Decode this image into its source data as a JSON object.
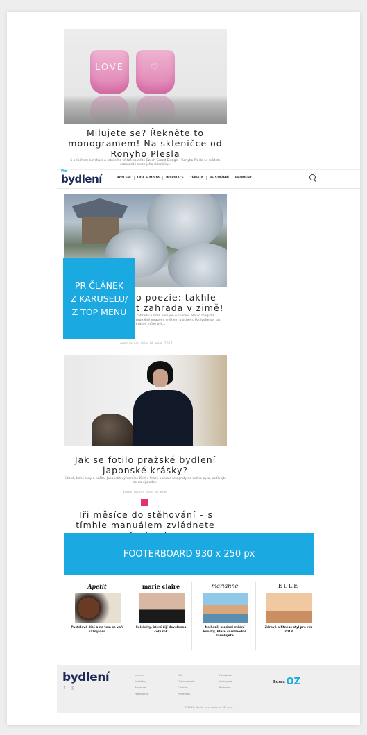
{
  "articles": [
    {
      "title": "Milujete se? Řekněte to monogramem! Na skleničce od Ronyho Plesla",
      "excerpt": "S příběhem návrháře a letošního vítěze soutěže Czech Grand Design – Ronyho Plesla se můžete seznámit i skrze jeho skleničky...",
      "glass_left": "LOVE",
      "glass_right": "♡"
    },
    {
      "title": "Zimní poezie: takhle vypadá zahrada v zimě!",
      "title_visible_part1": "o poezie: takhle",
      "title_visible_part2": "t zahrada v zimě!",
      "excerpt": "Zahrada v zimě není jen o spánku, ale i o magické proměně mrazem, sněhem a tichem. Podívejte se, jak krásné může být...",
      "meta": "Lorem ipsum, dolor sit amet, 2017"
    },
    {
      "title": "Jak se fotilo pražské bydlení japonské krásky?",
      "excerpt": "Sítová, tiché tóny a kočka. Japonská výtvarnice žijící v Praze pozvala fotografy do svého bytu, podívejte se na výsledek.",
      "meta": "Lorem ipsum, dolor sit amet"
    },
    {
      "title": "Tři měsíce do stěhování – s tímhle manuálem zvládnete všechno!"
    }
  ],
  "nav": {
    "logo_top": "Pro",
    "logo": "bydlení",
    "items": [
      "BYDLENÍ",
      "LIDÉ & MÍSTA",
      "INSPIRACE",
      "TÉMATA",
      "BE STAŽENÍ",
      "PROMĚNY"
    ],
    "search_icon": "search-icon"
  },
  "promo_box": {
    "line1": "PR ČLÁNEK",
    "line2": "Z KARUSELU/",
    "line3": "Z TOP MENU",
    "color": "#1aa9e0"
  },
  "footerboard": {
    "label": "FOOTERBOARD 930 x 250 px",
    "color": "#1aa9e0"
  },
  "partners": [
    {
      "brand": "Apetit",
      "caption": "Pastelové dítě a na tom se vaří každý den"
    },
    {
      "brand": "marie claire",
      "caption": "Celebrity, které žijí dovolenou celý rok"
    },
    {
      "brand": "marianne",
      "caption": "Nejhezčí sezónní módní kousky, které si rozhodně zamilujete"
    },
    {
      "brand": "ELLE",
      "caption": "Zdravá a fitness styl pro rok 2018"
    }
  ],
  "footer": {
    "logo": "bydlení",
    "col1": [
      "Inzerce",
      "Kontakty",
      "Redakce",
      "Předplatné"
    ],
    "col2": [
      "RSS",
      "Ochrana dat",
      "Cookies",
      "Podmínky"
    ],
    "col3": [
      "Facebook",
      "Instagram",
      "Pinterest"
    ],
    "publisher": "Burda",
    "publisher_oz": "OZ",
    "copyright": "© 2018, Burda International CZ s.r.o.",
    "social_fb": "f",
    "social_ig": "◎"
  }
}
